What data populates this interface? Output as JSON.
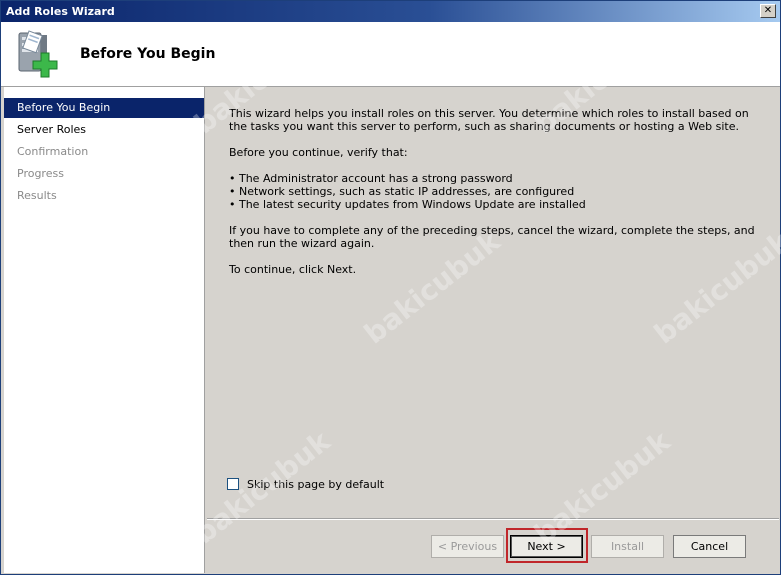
{
  "window": {
    "title": "Add Roles Wizard",
    "close_glyph": "✕"
  },
  "header": {
    "title": "Before You Begin",
    "icon": "server-add-icon"
  },
  "sidebar": {
    "items": [
      {
        "label": "Before You Begin",
        "state": "selected"
      },
      {
        "label": "Server Roles",
        "state": "enabled"
      },
      {
        "label": "Confirmation",
        "state": "disabled"
      },
      {
        "label": "Progress",
        "state": "disabled"
      },
      {
        "label": "Results",
        "state": "disabled"
      }
    ]
  },
  "content": {
    "intro": "This wizard helps you install roles on this server. You determine which roles to install based on the tasks you want this server to perform, such as sharing documents or hosting a Web site.",
    "verify_heading": "Before you continue, verify that:",
    "bullets": [
      "• The Administrator account has a strong password",
      "• Network settings, such as static IP addresses, are configured",
      "• The latest security updates from Windows Update are installed"
    ],
    "complete_steps": "If you have to complete any of the preceding steps, cancel the wizard, complete the steps, and then run the wizard again.",
    "continue_text": "To continue, click Next.",
    "skip_checkbox": {
      "label": "Skip this page by default",
      "checked": false
    }
  },
  "buttons": {
    "previous": "< Previous",
    "next": "Next >",
    "install": "Install",
    "cancel": "Cancel"
  },
  "watermark_text": "bakicubuk",
  "colors": {
    "titlebar": "#0a246a",
    "selected_nav": "#0a246a",
    "highlight_box": "#c0262a",
    "panel": "#d6d3ce"
  }
}
